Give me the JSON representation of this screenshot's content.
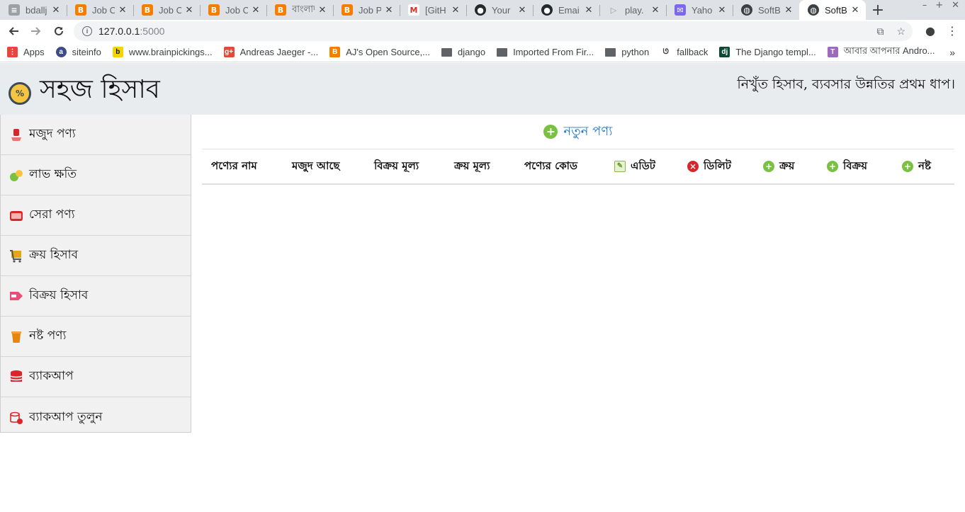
{
  "browser": {
    "tabs": [
      {
        "title": "bdallj",
        "favicon": "file-icon",
        "color": "#9aa0a6"
      },
      {
        "title": "Job Ci",
        "favicon": "blogger-icon",
        "color": "#f57d00"
      },
      {
        "title": "Job Ci",
        "favicon": "blogger-icon",
        "color": "#f57d00"
      },
      {
        "title": "Job Ci",
        "favicon": "blogger-icon",
        "color": "#f57d00"
      },
      {
        "title": "বাংলাদ",
        "favicon": "blogger-icon",
        "color": "#f57d00"
      },
      {
        "title": "Job Pl",
        "favicon": "blogger-icon",
        "color": "#f57d00"
      },
      {
        "title": "[GitH",
        "favicon": "gmail-icon",
        "color": "#d93025"
      },
      {
        "title": "Your",
        "favicon": "github-icon",
        "color": "#24292e"
      },
      {
        "title": "Emai",
        "favicon": "github-icon",
        "color": "#24292e"
      },
      {
        "title": "play.",
        "favicon": "play-icon",
        "color": "#9aa0a6"
      },
      {
        "title": "Yaho",
        "favicon": "yahoo-icon",
        "color": "#7b68ee"
      },
      {
        "title": "SoftB",
        "favicon": "globe-icon",
        "color": "#3c4043"
      },
      {
        "title": "SoftB",
        "favicon": "globe-icon",
        "color": "#3c4043",
        "active": true
      }
    ],
    "address": {
      "host": "127.0.0.1",
      "port": ":5000"
    },
    "bookmarks": [
      {
        "label": "Apps",
        "icon": "apps-icon",
        "color": "#e8453c"
      },
      {
        "label": "siteinfo",
        "icon": "siteinfo-icon",
        "color": "#3c4b8a"
      },
      {
        "label": "www.brainpickings...",
        "icon": "brainpickings-icon",
        "color": "#f2d600"
      },
      {
        "label": "Andreas Jaeger -...",
        "icon": "google-plus-icon",
        "color": "#dd4b39"
      },
      {
        "label": "AJ's Open Source,...",
        "icon": "blogger-icon",
        "color": "#f57d00"
      },
      {
        "label": "django",
        "icon": "folder-icon",
        "color": "#5f6368"
      },
      {
        "label": "Imported From Fir...",
        "icon": "folder-icon",
        "color": "#5f6368"
      },
      {
        "label": "python",
        "icon": "folder-icon",
        "color": "#5f6368"
      },
      {
        "label": "fallback",
        "icon": "fallback-icon",
        "color": "#3c4043"
      },
      {
        "label": "The Django templ...",
        "icon": "django-icon",
        "color": "#0c4b33"
      },
      {
        "label": "আবার আপনার Andro...",
        "icon": "android-icon",
        "color": "#9c6ab8"
      }
    ]
  },
  "header": {
    "title": "সহজ হিসাব",
    "tagline": "নিখুঁত হিসাব, ব্যবসার উন্নতির প্রথম ধাপ।"
  },
  "sidebar": {
    "items": [
      {
        "label": "মজুদ পণ্য",
        "icon": "stock-icon",
        "color": "#d9262b"
      },
      {
        "label": "লাভ ক্ষতি",
        "icon": "money-bag-icon",
        "color": "#7ac142"
      },
      {
        "label": "সেরা পণ্য",
        "icon": "hot-deal-icon",
        "color": "#d9262b"
      },
      {
        "label": "ক্রয় হিসাব",
        "icon": "cart-icon",
        "color": "#e8a317"
      },
      {
        "label": "বিক্রয় হিসাব",
        "icon": "sale-tag-icon",
        "color": "#e94e77"
      },
      {
        "label": "নষ্ট পণ্য",
        "icon": "trash-icon",
        "color": "#e8830c"
      },
      {
        "label": "ব্যাকআপ",
        "icon": "database-icon",
        "color": "#d9262b"
      },
      {
        "label": "ব্যাকআপ তুলুন",
        "icon": "database-restore-icon",
        "color": "#d9262b"
      }
    ]
  },
  "main": {
    "add_label": "নতুন পণ্য",
    "columns": [
      {
        "label": "পণ্যের নাম",
        "icon": ""
      },
      {
        "label": "মজুদ আছে",
        "icon": ""
      },
      {
        "label": "বিক্রয় মূল্য",
        "icon": ""
      },
      {
        "label": "ক্রয় মূল্য",
        "icon": ""
      },
      {
        "label": "পণ্যের কোড",
        "icon": ""
      },
      {
        "label": "এডিট",
        "icon": "edit-icon"
      },
      {
        "label": "ডিলিট",
        "icon": "delete-icon"
      },
      {
        "label": "ক্রয়",
        "icon": "plus-icon"
      },
      {
        "label": "বিক্রয়",
        "icon": "plus-icon"
      },
      {
        "label": "নষ্ট",
        "icon": "plus-icon"
      }
    ]
  }
}
